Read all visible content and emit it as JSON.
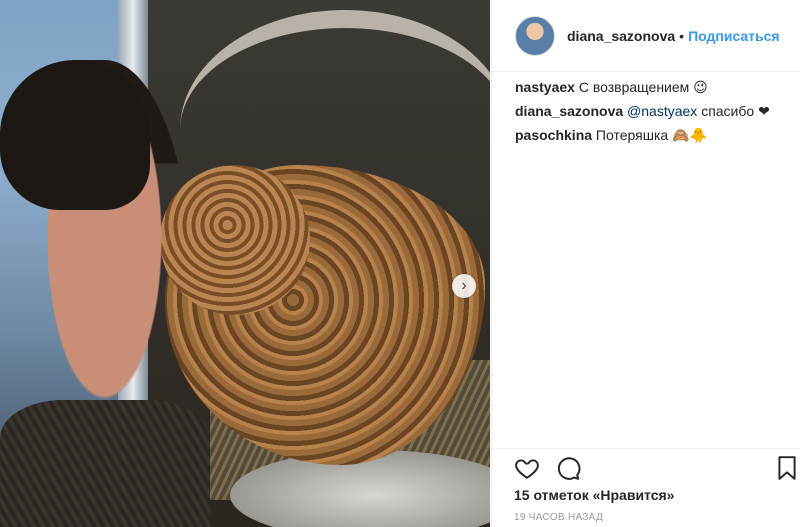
{
  "post": {
    "author": "diana_sazonova",
    "separator": "•",
    "follow_label": "Подписаться"
  },
  "comments": [
    {
      "user": "nastyaex",
      "text": "С возвращением 😉"
    },
    {
      "user": "diana_sazonova",
      "mention": "@nastyaex",
      "text": "спасибо ❤"
    },
    {
      "user": "pasochkina",
      "text": "Потеряшка 🙈🐥"
    }
  ],
  "likes_text": "15 отметок «Нравится»",
  "timestamp": "19 часов назад",
  "colors": {
    "link": "#3897f0",
    "mention": "#003569",
    "muted": "#999999"
  },
  "icons": [
    "chevron-right-icon",
    "heart-icon",
    "comment-icon",
    "bookmark-icon"
  ]
}
